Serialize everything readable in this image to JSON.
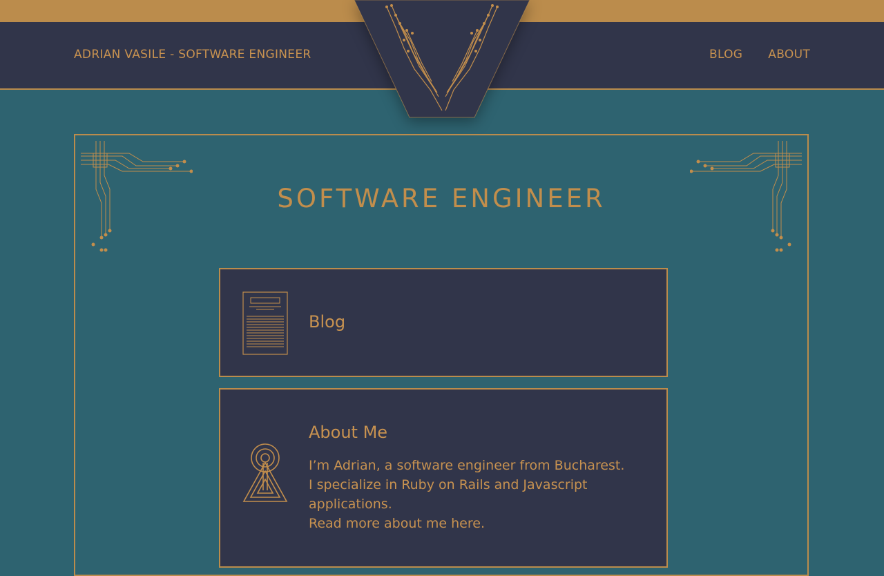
{
  "header": {
    "site_title": "ADRIAN VASILE - SOFTWARE ENGINEER",
    "nav": [
      {
        "label": "BLOG"
      },
      {
        "label": "ABOUT"
      }
    ]
  },
  "main": {
    "page_title": "SOFTWARE ENGINEER",
    "cards": [
      {
        "title": "Blog"
      },
      {
        "title": "About Me",
        "line1": "I’m Adrian, a software engineer from Bucharest.",
        "line2": "I specialize in Ruby on Rails and Javascript applications.",
        "link": "Read more about me here."
      }
    ]
  },
  "icons": {
    "logo": "v-circuit-logo",
    "corner": "circuit-corner-ornament",
    "blog": "document-icon",
    "about": "radio-tower-icon"
  },
  "colors": {
    "accent": "#bb8c4c",
    "header_bg": "#31354a",
    "page_bg": "#2e6370",
    "card_bg": "#31354a"
  }
}
